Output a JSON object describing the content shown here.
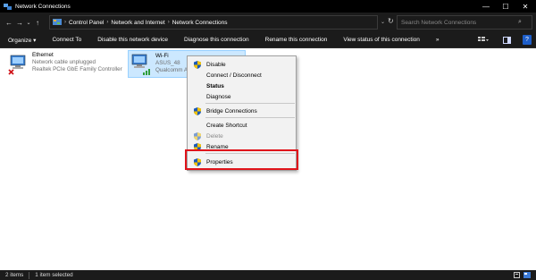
{
  "window": {
    "title": "Network Connections",
    "minimize": "—",
    "maximize": "☐",
    "close": "✕"
  },
  "address": {
    "back": "←",
    "forward": "→",
    "up": "↑",
    "crumbs": [
      "Control Panel",
      "Network and Internet",
      "Network Connections"
    ],
    "search_placeholder": "Search Network Connections"
  },
  "toolbar": {
    "organize": "Organize ▾",
    "connect_to": "Connect To",
    "disable_device": "Disable this network device",
    "diagnose": "Diagnose this connection",
    "rename": "Rename this connection",
    "view_status": "View status of this connection",
    "more": "»"
  },
  "adapters": [
    {
      "name": "Ethernet",
      "status": "Network cable unplugged",
      "device": "Realtek PCIe GbE Family Controller"
    },
    {
      "name": "Wi-Fi",
      "status": "ASUS_48",
      "device": "Qualcomm At"
    }
  ],
  "context_menu": {
    "disable": "Disable",
    "connect": "Connect / Disconnect",
    "status": "Status",
    "diagnose": "Diagnose",
    "bridge": "Bridge Connections",
    "shortcut": "Create Shortcut",
    "delete": "Delete",
    "rename": "Rename",
    "properties": "Properties"
  },
  "statusbar": {
    "items": "2 items",
    "selected": "1 item selected"
  },
  "colors": {
    "highlight_box": "#e0141b",
    "selection": "#cce8ff",
    "shield_blue": "#1c5bb8",
    "shield_yellow": "#f2c200"
  }
}
